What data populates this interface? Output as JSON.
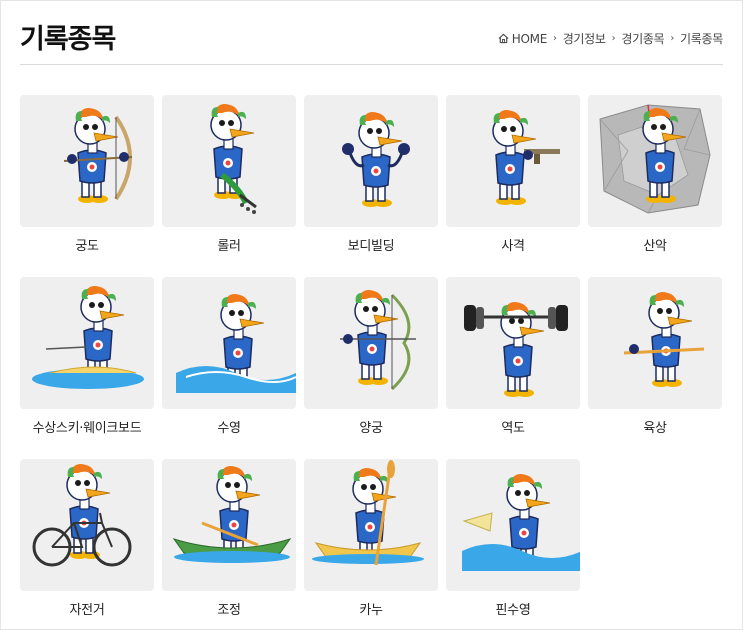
{
  "page": {
    "title": "기록종목"
  },
  "breadcrumb": {
    "home": "HOME",
    "items": [
      "경기정보",
      "경기종목",
      "기록종목"
    ]
  },
  "sports": [
    {
      "label": "궁도",
      "prop": "bow-icon"
    },
    {
      "label": "롤러",
      "prop": "roller-skate-icon"
    },
    {
      "label": "보디빌딩",
      "prop": "muscle-pose-icon"
    },
    {
      "label": "사격",
      "prop": "pistol-icon"
    },
    {
      "label": "산악",
      "prop": "climbing-wall-icon"
    },
    {
      "label": "수상스키·웨이크보드",
      "prop": "wakeboard-icon"
    },
    {
      "label": "수영",
      "prop": "swimming-icon"
    },
    {
      "label": "양궁",
      "prop": "recurve-bow-icon"
    },
    {
      "label": "역도",
      "prop": "barbell-icon"
    },
    {
      "label": "육상",
      "prop": "running-icon"
    },
    {
      "label": "자전거",
      "prop": "bicycle-icon"
    },
    {
      "label": "조정",
      "prop": "rowing-boat-icon"
    },
    {
      "label": "카누",
      "prop": "canoe-icon"
    },
    {
      "label": "핀수영",
      "prop": "fin-swimming-icon"
    }
  ],
  "colors": {
    "card_bg": "#efefef",
    "mascot_body": "#ffffff",
    "mascot_beak": "#f3a61c",
    "mascot_crest_orange": "#f07a1a",
    "mascot_crest_green": "#4caf50",
    "mascot_shirt": "#2b67c6",
    "mascot_glove": "#1f2d6b",
    "water": "#3aa8e8"
  }
}
